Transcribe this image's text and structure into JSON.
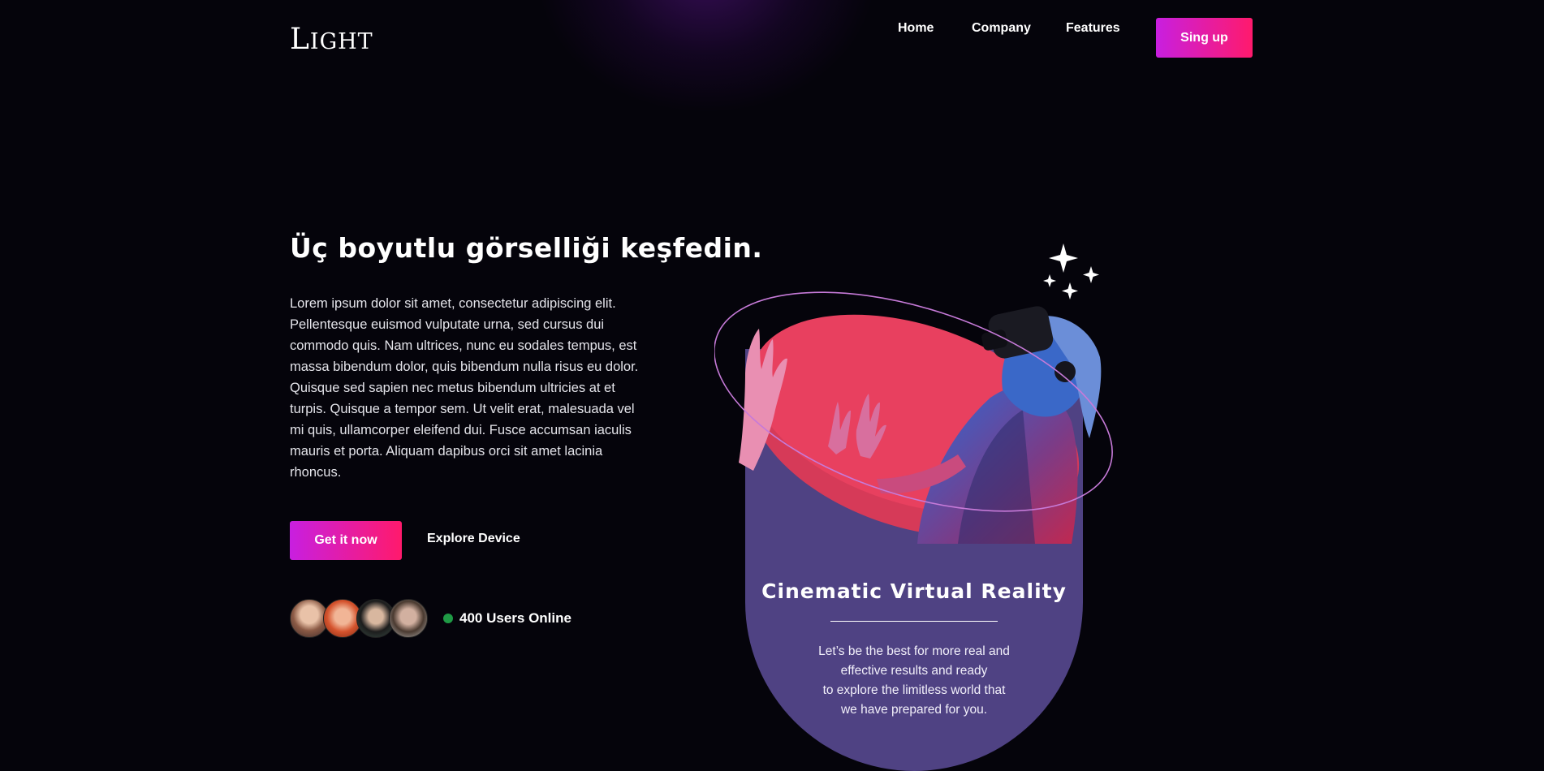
{
  "brand": {
    "name": "Light",
    "first_letter": "L",
    "rest": "IGHT"
  },
  "nav": {
    "links": [
      {
        "label": "Home"
      },
      {
        "label": "Company"
      },
      {
        "label": "Features"
      }
    ],
    "signup_label": "Sing up"
  },
  "hero": {
    "headline": "Üç boyutlu görselliği keşfedin.",
    "body": "Lorem ipsum dolor sit amet, consectetur adipiscing elit. Pellentesque euismod vulputate urna, sed cursus dui commodo quis. Nam ultrices, nunc eu sodales tempus, est massa bibendum dolor, quis bibendum nulla risus eu dolor. Quisque sed sapien nec metus bibendum ultricies at et turpis. Quisque a tempor sem. Ut velit erat, malesuada vel mi quis, ullamcorper eleifend dui. Fusce accumsan iaculis mauris et porta. Aliquam dapibus orci sit amet lacinia rhoncus.",
    "cta_label": "Get it now",
    "secondary_label": "Explore Device",
    "online_text": "400 Users Online"
  },
  "card": {
    "title": "Cinematic Virtual Reality",
    "text_lines": [
      "Let’s be the best for more real and",
      "effective results and ready",
      "to explore the limitless world that",
      "we have prepared for you."
    ]
  },
  "colors": {
    "background": "#05040b",
    "accent_start": "#c81fe0",
    "accent_end": "#ff1a6c",
    "card": "#4f4283",
    "disc": "#e8405f",
    "online_dot": "#1f9a45"
  }
}
